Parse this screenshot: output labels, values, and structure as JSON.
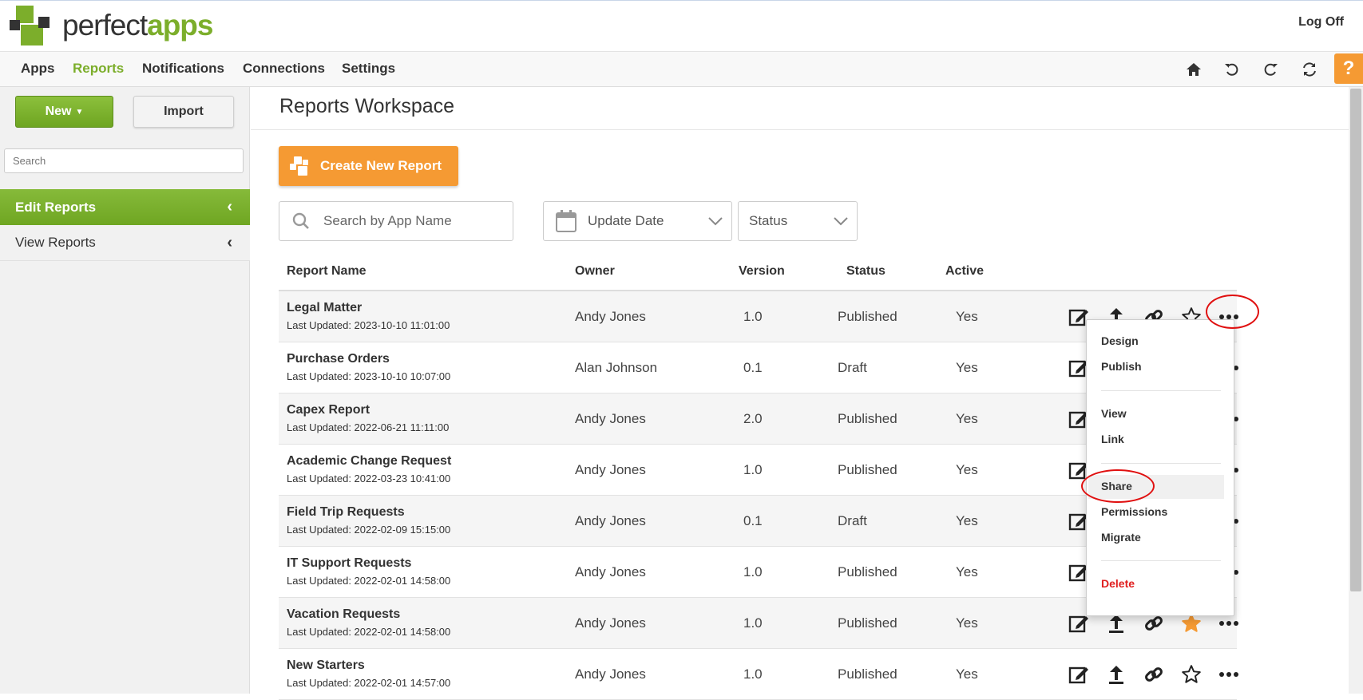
{
  "header": {
    "brand_primary": "perfect",
    "brand_accent": "apps",
    "logoff_label": "Log Off",
    "brand_color": "#7cae2b"
  },
  "nav": {
    "items": [
      {
        "label": "Apps"
      },
      {
        "label": "Reports"
      },
      {
        "label": "Notifications"
      },
      {
        "label": "Connections"
      },
      {
        "label": "Settings"
      }
    ],
    "active": "Reports",
    "right_icons": [
      "home-icon",
      "undo-icon",
      "redo-icon",
      "refresh-icon"
    ],
    "help_label": "?"
  },
  "sidebar": {
    "new_label": "New",
    "import_label": "Import",
    "search_placeholder": "Search",
    "items": [
      {
        "label": "Edit Reports"
      },
      {
        "label": "View Reports"
      }
    ]
  },
  "main": {
    "title": "Reports Workspace",
    "create_label": "Create New Report",
    "filters": {
      "search_placeholder": "Search by App Name",
      "date_label": "Update Date",
      "status_label": "Status"
    },
    "columns": {
      "name": "Report Name",
      "owner": "Owner",
      "version": "Version",
      "status": "Status",
      "active": "Active"
    },
    "rows": [
      {
        "name": "Legal Matter",
        "updated": "Last Updated: 2023-10-10 11:01:00",
        "owner": "Andy Jones",
        "version": "1.0",
        "status": "Published",
        "active": "Yes",
        "favorite": false
      },
      {
        "name": "Purchase Orders",
        "updated": "Last Updated: 2023-10-10 10:07:00",
        "owner": "Alan Johnson",
        "version": "0.1",
        "status": "Draft",
        "active": "Yes",
        "favorite": false
      },
      {
        "name": "Capex Report",
        "updated": "Last Updated: 2022-06-21 11:11:00",
        "owner": "Andy Jones",
        "version": "2.0",
        "status": "Published",
        "active": "Yes",
        "favorite": false
      },
      {
        "name": "Academic Change Request",
        "updated": "Last Updated: 2022-03-23 10:41:00",
        "owner": "Andy Jones",
        "version": "1.0",
        "status": "Published",
        "active": "Yes",
        "favorite": false
      },
      {
        "name": "Field Trip Requests",
        "updated": "Last Updated: 2022-02-09 15:15:00",
        "owner": "Andy Jones",
        "version": "0.1",
        "status": "Draft",
        "active": "Yes",
        "favorite": false
      },
      {
        "name": "IT Support Requests",
        "updated": "Last Updated: 2022-02-01 14:58:00",
        "owner": "Andy Jones",
        "version": "1.0",
        "status": "Published",
        "active": "Yes",
        "favorite": false
      },
      {
        "name": "Vacation Requests",
        "updated": "Last Updated: 2022-02-01 14:58:00",
        "owner": "Andy Jones",
        "version": "1.0",
        "status": "Published",
        "active": "Yes",
        "favorite": true
      },
      {
        "name": "New Starters",
        "updated": "Last Updated: 2022-02-01 14:57:00",
        "owner": "Andy Jones",
        "version": "1.0",
        "status": "Published",
        "active": "Yes",
        "favorite": false
      }
    ]
  },
  "menu": {
    "items": [
      "Design",
      "Publish",
      "View",
      "Link",
      "Share",
      "Permissions",
      "Migrate",
      "Delete"
    ],
    "highlighted": "Share",
    "danger_color": "#e02020"
  },
  "colors": {
    "green": "#7cae2b",
    "orange": "#f59a33",
    "star": "#f59a33"
  }
}
